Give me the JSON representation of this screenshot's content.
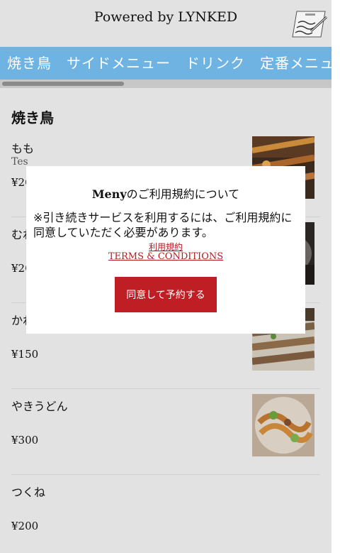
{
  "header": {
    "title": "Powered by LYNKED",
    "logo_icon": "notepad-pen-icon"
  },
  "tabs": [
    {
      "label": "焼き鳥"
    },
    {
      "label": "サイドメニュー"
    },
    {
      "label": "ドリンク"
    },
    {
      "label": "定番メニュー"
    }
  ],
  "section": {
    "title": "焼き鳥"
  },
  "items": [
    {
      "name": "もも",
      "description": "Tes",
      "price": "¥20"
    },
    {
      "name": "むね",
      "description": "",
      "price": "¥20"
    },
    {
      "name": "かわ",
      "description": "",
      "price": "¥150"
    },
    {
      "name": "やきうどん",
      "description": "",
      "price": "¥300"
    },
    {
      "name": "つくね",
      "description": "",
      "price": "¥200"
    }
  ],
  "modal": {
    "title_brand": "Meny",
    "title_rest": "のご利用規約について",
    "body": "※引き続きサービスを利用するには、ご利用規約に同意していただく必要があります。",
    "link_terms_ja": "利用規約",
    "link_terms_en": "TERMS & CONDITIONS",
    "agree_button": "同意して予約する"
  },
  "colors": {
    "tab_bar": "#6fb3e2",
    "accent": "#be1e24",
    "background": "#e2e2e2"
  }
}
